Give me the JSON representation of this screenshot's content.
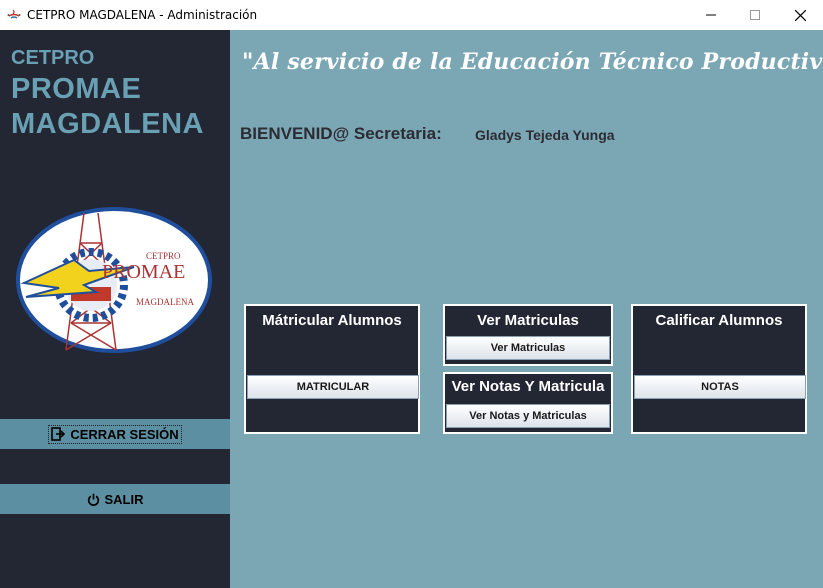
{
  "window": {
    "title": "CETPRO MAGDALENA - Administración"
  },
  "sidebar": {
    "brand_small": "CETPRO",
    "brand_line1": "PROMAE",
    "brand_line2": "MAGDALENA",
    "logo": {
      "top_text": "CETPRO",
      "main_text": "PROMAE",
      "bottom_text": "MAGDALENA"
    },
    "logout_label": "CERRAR SESIÓN",
    "exit_label": "SALIR"
  },
  "main": {
    "slogan": "\"Al servicio de la Educación Técnico Productiva\"",
    "welcome_label": "BIENVENID@ Secretaria:",
    "user_name": "Gladys Tejeda Yunga",
    "cards": {
      "matricular": {
        "title": "Mátricular Alumnos",
        "button": "MATRICULAR"
      },
      "ver_matriculas": {
        "title": "Ver Matriculas",
        "button": "Ver Matriculas"
      },
      "ver_notas": {
        "title": "Ver Notas Y Matricula",
        "button": "Ver Notas y  Matriculas"
      },
      "calificar": {
        "title": "Calificar Alumnos",
        "button": "NOTAS"
      }
    }
  },
  "colors": {
    "sidebar_bg": "#232633",
    "main_bg": "#7ba7b5",
    "accent": "#6aa0b4",
    "side_button": "#5d8fa3",
    "card_bg": "#232633"
  }
}
